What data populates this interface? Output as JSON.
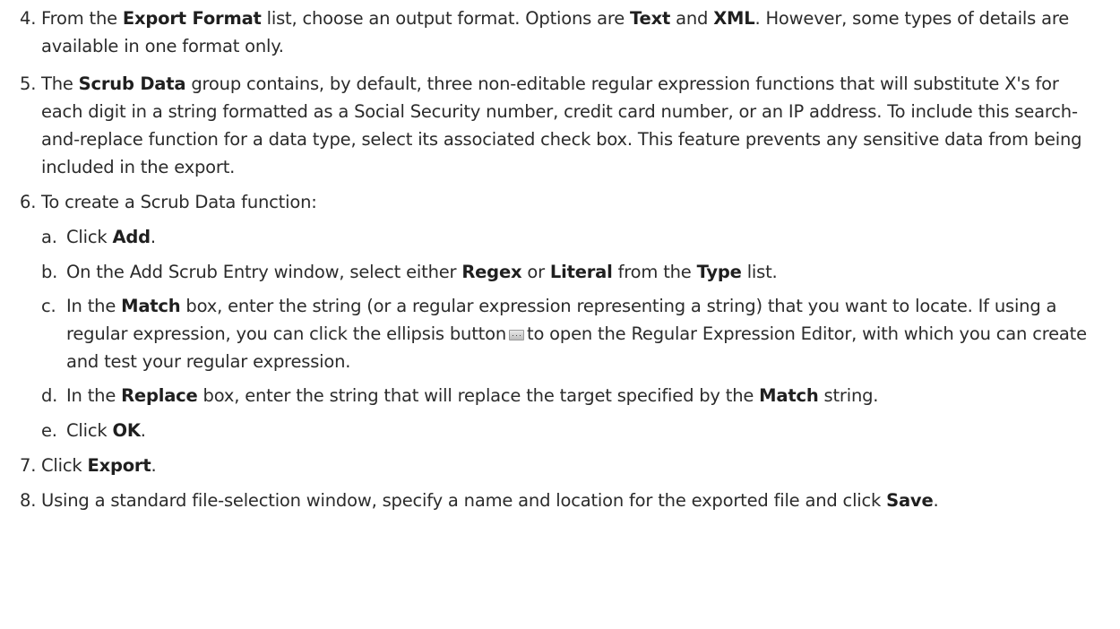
{
  "steps": {
    "s4": {
      "num": "4.",
      "t1": "From the ",
      "b1": "Export Format",
      "t2": " list, choose an output format. Options are ",
      "b2": "Text",
      "t3": " and ",
      "b3": "XML",
      "t4": ". However, some types of details are available in one format only."
    },
    "s5": {
      "num": "5.",
      "t1": "The ",
      "b1": "Scrub Data",
      "t2": " group contains, by default, three non-editable regular expression functions that will substitute X's for each digit in a string formatted as a Social Security number, credit card number, or an IP address. To include this search-and-replace function for a data type, select its associated check box. This feature prevents any sensitive data from being included in the export."
    },
    "s6": {
      "num": "6.",
      "t1": "To create a Scrub Data function:"
    },
    "s7": {
      "num": "7.",
      "t1": "Click ",
      "b1": "Export",
      "t2": "."
    },
    "s8": {
      "num": "8.",
      "t1": "Using a standard file-selection window, specify a name and location for the exported file and click ",
      "b1": "Save",
      "t2": "."
    }
  },
  "substeps": {
    "a": {
      "num": "a.",
      "t1": "Click ",
      "b1": "Add",
      "t2": "."
    },
    "b": {
      "num": "b.",
      "t1": "On the Add Scrub Entry window, select either ",
      "b1": "Regex",
      "t2": " or ",
      "b2": "Literal",
      "t3": " from the ",
      "b3": "Type",
      "t4": " list."
    },
    "c": {
      "num": "c.",
      "t1": "In the ",
      "b1": "Match",
      "t2": " box, enter the string (or a regular expression representing a string) that you want to locate. If using a regular expression, you can click the ellipsis button",
      "t3": "to open the Regular Expression Editor, with which you can create and test your regular expression."
    },
    "d": {
      "num": "d.",
      "t1": "In the ",
      "b1": "Replace",
      "t2": " box, enter the string that will replace the target specified by the ",
      "b2": "Match",
      "t3": " string."
    },
    "e": {
      "num": "e.",
      "t1": "Click ",
      "b1": "OK",
      "t2": "."
    }
  },
  "icons": {
    "ellipsis_button": "ellipsis-button-icon"
  }
}
